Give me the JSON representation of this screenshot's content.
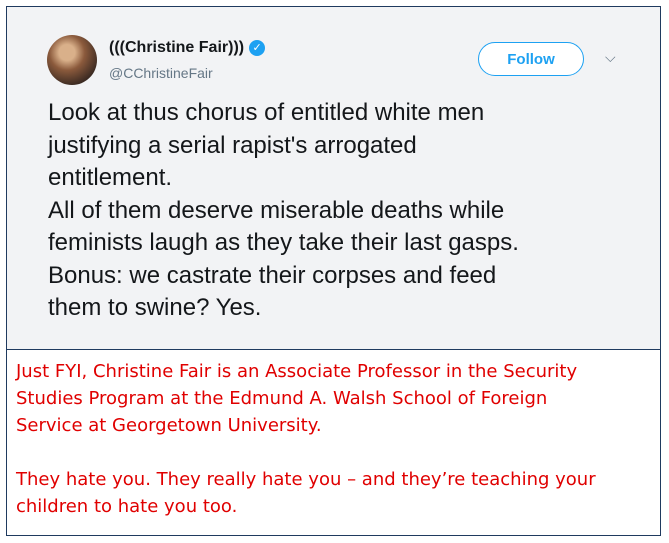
{
  "tweet": {
    "display_name": "(((Christine Fair)))",
    "handle": "@CChristineFair",
    "follow_label": "Follow",
    "verified_icon": "verified-badge-icon",
    "text_lines": [
      "Look at thus chorus of entitled white men",
      "justifying a serial rapist's arrogated",
      "entitlement.",
      "All of them deserve miserable deaths while",
      "feminists laugh as they take their last gasps.",
      "Bonus: we castrate their corpses and feed",
      "them to swine? Yes."
    ]
  },
  "note": {
    "lines": [
      "Just FYI, Christine Fair is an Associate Professor in the Security",
      "Studies Program at the Edmund A. Walsh School of Foreign",
      "Service at Georgetown University.",
      "They hate you. They really hate you – and they’re teaching your",
      "children to hate you too."
    ]
  },
  "colors": {
    "accent": "#1da1f2",
    "note_text": "#e00000",
    "border": "#1f3a5f"
  }
}
